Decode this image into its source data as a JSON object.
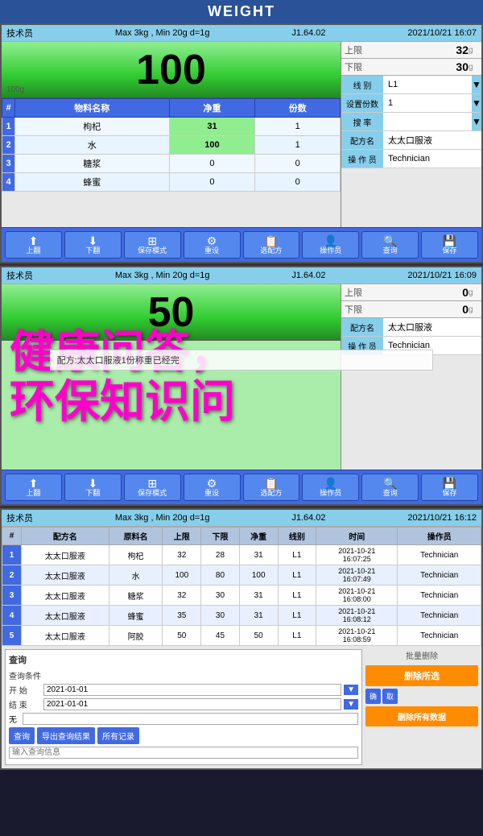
{
  "app": {
    "title": "WEIGHT"
  },
  "panel1": {
    "header": {
      "role": "技术员",
      "specs": "Max 3kg , Min 20g  d=1g",
      "firmware": "J1.64.02",
      "datetime": "2021/10/21  16:07"
    },
    "weight": {
      "value": "100",
      "unit": "g",
      "left_label": "100g"
    },
    "upper_limit": {
      "label": "上限",
      "value": "32",
      "unit": "g"
    },
    "lower_limit": {
      "label": "下限",
      "value": "30",
      "unit": "g"
    },
    "table": {
      "headers": [
        "物料名称",
        "净重",
        "份数"
      ],
      "rows": [
        {
          "num": "1",
          "name": "枸杞",
          "weight": "31",
          "count": "1",
          "weight_green": true
        },
        {
          "num": "2",
          "name": "水",
          "weight": "100",
          "count": "1",
          "weight_green": true
        },
        {
          "num": "3",
          "name": "糖浆",
          "weight": "0",
          "count": "0"
        },
        {
          "num": "4",
          "name": "蜂蜜",
          "weight": "0",
          "count": "0"
        }
      ]
    },
    "info": {
      "line_label": "线 别",
      "line_value": "L1",
      "servings_label": "设置份数",
      "servings_value": "1",
      "rate_label": "搜 率",
      "formula_label": "配方名",
      "formula_value": "太太口服液",
      "operator_label": "操 作 员",
      "operator_value": "Technician"
    },
    "toolbar": {
      "btn1_label": "上翻",
      "btn2_label": "下翻",
      "btn3_label": "保存模式",
      "btn4_label": "重设",
      "btn5_label": "选配方",
      "btn6_label": "操作员",
      "btn7_label": "查询",
      "btn8_label": "保存"
    }
  },
  "panel2": {
    "header": {
      "role": "技术员",
      "specs": "Max 3kg , Min 20g  d=1g",
      "firmware": "J1.64.02",
      "datetime": "2021/10/21  16:09"
    },
    "weight": {
      "value": "50",
      "unit": "g"
    },
    "upper_limit": {
      "label": "上限",
      "value": "0",
      "unit": "g"
    },
    "lower_limit": {
      "label": "下限",
      "value": "0",
      "unit": "g"
    },
    "overlay_text": {
      "line1": "健康问答，",
      "line2": "环保知识问"
    },
    "alert": "配方:太太口服液1份称重已经完",
    "info": {
      "formula_label": "配方名",
      "formula_value": "太太口服液",
      "operator_label": "操 作 员",
      "operator_value": "Technician"
    },
    "toolbar": {
      "btn1_label": "上翻",
      "btn2_label": "下翻",
      "btn3_label": "保存模式",
      "btn4_label": "重设",
      "btn5_label": "选配方",
      "btn6_label": "操作员",
      "btn7_label": "查询",
      "btn8_label": "保存"
    }
  },
  "panel3": {
    "header": {
      "role": "技术员",
      "specs": "Max 3kg , Min 20g  d=1g",
      "firmware": "J1.64.02",
      "datetime": "2021/10/21  16:12"
    },
    "table": {
      "headers": [
        "配方名",
        "原料名",
        "上限",
        "下限",
        "净重",
        "线别",
        "时间",
        "操作员"
      ],
      "rows": [
        {
          "num": "1",
          "formula": "太太口服液",
          "material": "枸杞",
          "upper": "32",
          "lower": "28",
          "net": "31",
          "line": "L1",
          "time": "2021-10-21\n16:07:25",
          "operator": "Technician"
        },
        {
          "num": "2",
          "formula": "太太口服液",
          "material": "水",
          "upper": "100",
          "lower": "80",
          "net": "100",
          "line": "L1",
          "time": "2021-10-21\n16:07:49",
          "operator": "Technician"
        },
        {
          "num": "3",
          "formula": "太太口服液",
          "material": "糖浆",
          "upper": "32",
          "lower": "30",
          "net": "31",
          "line": "L1",
          "time": "2021-10-21\n16:08:00",
          "operator": "Technician"
        },
        {
          "num": "4",
          "formula": "太太口服液",
          "material": "蜂蜜",
          "upper": "35",
          "lower": "30",
          "net": "31",
          "line": "L1",
          "time": "2021-10-21\n16:08:12",
          "operator": "Technician"
        },
        {
          "num": "5",
          "formula": "太太口服液",
          "material": "阿胶",
          "upper": "50",
          "lower": "45",
          "net": "50",
          "line": "L1",
          "time": "2021-10-21\n16:08:59",
          "operator": "Technician"
        }
      ]
    },
    "query": {
      "title": "查询",
      "condition_label": "查询条件",
      "start_label": "开 始",
      "start_value": "2021-01-01",
      "end_label": "结 束",
      "end_value": "2021-01-01",
      "none_label": "无",
      "search_btn": "查询",
      "export_btn": "导出查询结果",
      "all_records_btn": "所有记录",
      "search_placeholder": "输入查询信息"
    },
    "batch": {
      "title": "批量删除",
      "delete_selected_btn": "删除所选",
      "confirm_btn": "确",
      "cancel_btn": "取",
      "delete_all_btn": "删除所有数据"
    }
  }
}
